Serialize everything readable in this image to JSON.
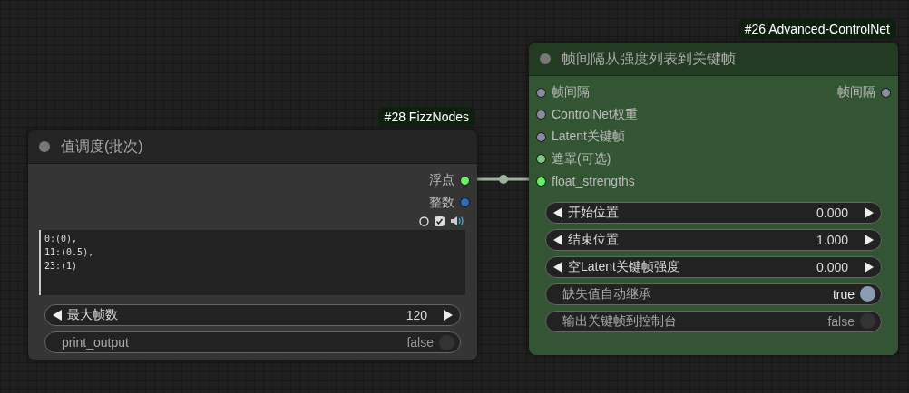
{
  "nodes": [
    {
      "badge": "#28 FizzNodes",
      "title": "值调度(批次)",
      "color": "#353535",
      "outputs": [
        {
          "label": "浮点",
          "color": "#66ee66"
        },
        {
          "label": "整数",
          "color": "#2a6fb0"
        }
      ],
      "preview_toggles": {
        "checked": true
      },
      "text_value": "0:(0),\n11:(0.5),\n23:(1)",
      "widgets": [
        {
          "kind": "number",
          "label": "最大帧数",
          "value": "120"
        },
        {
          "kind": "toggle",
          "label": "print_output",
          "value": "false",
          "on": false
        }
      ]
    },
    {
      "badge": "#26 Advanced-ControlNet",
      "title": "帧间隔从强度列表到关键帧",
      "color": "#335533",
      "inputs": [
        {
          "label": "帧间隔",
          "color": "#8a8aa0"
        },
        {
          "label": "ControlNet权重",
          "color": "#8a8aa0"
        },
        {
          "label": "Latent关键帧",
          "color": "#8a8aa0"
        },
        {
          "label": "遮罩(可选)",
          "color": "#81c784"
        },
        {
          "label": "float_strengths",
          "color": "#66ee66"
        }
      ],
      "outputs": [
        {
          "label": "帧间隔",
          "color": "#8a8aa0"
        }
      ],
      "widgets": [
        {
          "kind": "number",
          "label": "开始位置",
          "value": "0.000"
        },
        {
          "kind": "number",
          "label": "结束位置",
          "value": "1.000"
        },
        {
          "kind": "number",
          "label": "空Latent关键帧强度",
          "value": "0.000"
        },
        {
          "kind": "toggle",
          "label": "缺失值自动继承",
          "value": "true",
          "on": true
        },
        {
          "kind": "toggle",
          "label": "输出关键帧到控制台",
          "value": "false",
          "on": false
        }
      ]
    }
  ]
}
